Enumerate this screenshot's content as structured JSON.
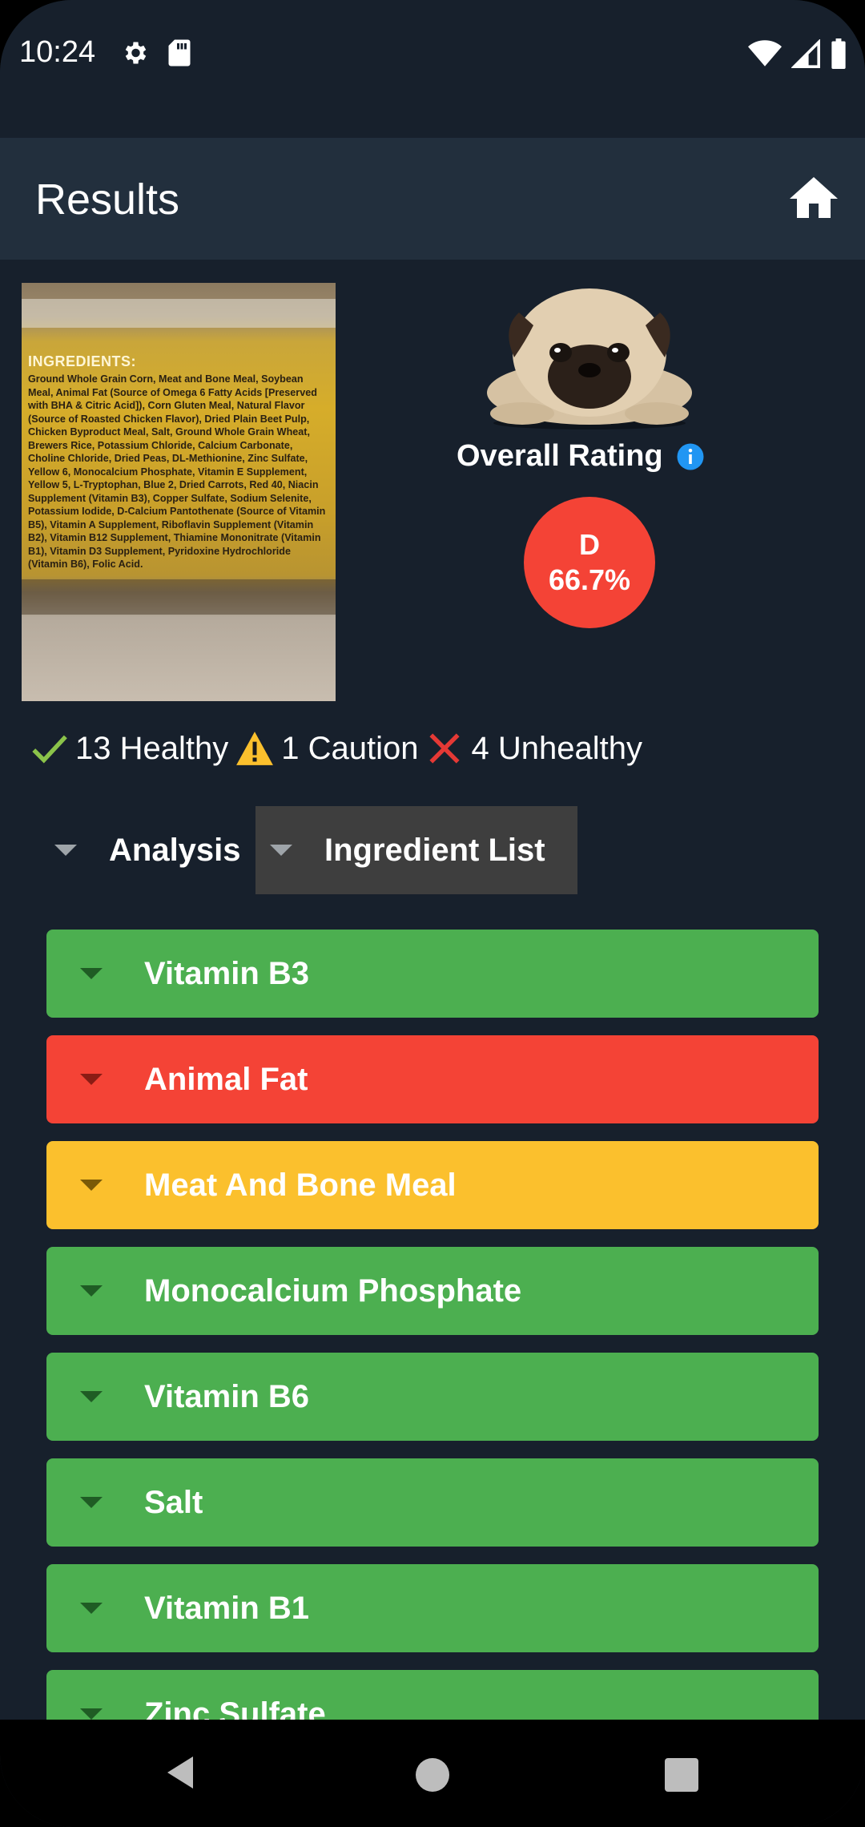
{
  "status": {
    "time": "10:24",
    "icons": [
      "settings-icon",
      "sd-card-icon",
      "wifi-icon",
      "signal-icon",
      "battery-icon"
    ]
  },
  "appbar": {
    "title": "Results",
    "home_icon": "home-icon"
  },
  "label_photo": {
    "heading": "INGREDIENTS:",
    "text": "Ground Whole Grain Corn, Meat and Bone Meal, Soybean Meal, Animal Fat (Source of Omega 6 Fatty Acids [Preserved with BHA & Citric Acid]), Corn Gluten Meal, Natural Flavor (Source of Roasted Chicken Flavor), Dried Plain Beet Pulp, Chicken Byproduct Meal, Salt, Ground Whole Grain Wheat, Brewers Rice, Potassium Chloride, Calcium Carbonate, Choline Chloride, Dried Peas, DL-Methionine, Zinc Sulfate, Yellow 6, Monocalcium Phosphate, Vitamin E Supplement, Yellow 5, L-Tryptophan, Blue 2, Dried Carrots, Red 40, Niacin Supplement (Vitamin B3), Copper Sulfate, Sodium Selenite, Potassium Iodide, D-Calcium Pantothenate (Source of Vitamin B5), Vitamin A Supplement, Riboflavin Supplement (Vitamin B2), Vitamin B12 Supplement, Thiamine Mononitrate (Vitamin B1), Vitamin D3 Supplement, Pyridoxine Hydrochloride (Vitamin B6), Folic Acid."
  },
  "rating": {
    "label": "Overall Rating",
    "grade": "D",
    "percent": "66.7%",
    "color": "#f44336"
  },
  "counts": {
    "healthy": "13 Healthy",
    "caution": "1 Caution",
    "unhealthy": "4 Unhealthy"
  },
  "tabs": {
    "analysis": "Analysis",
    "ingredient_list": "Ingredient List"
  },
  "ingredients": [
    {
      "label": "Vitamin B3",
      "status": "healthy"
    },
    {
      "label": "Animal Fat",
      "status": "unhealthy"
    },
    {
      "label": "Meat And Bone Meal",
      "status": "caution"
    },
    {
      "label": "Monocalcium Phosphate",
      "status": "healthy"
    },
    {
      "label": "Vitamin B6",
      "status": "healthy"
    },
    {
      "label": "Salt",
      "status": "healthy"
    },
    {
      "label": "Vitamin B1",
      "status": "healthy"
    },
    {
      "label": "Zinc Sulfate",
      "status": "healthy"
    }
  ],
  "colors": {
    "healthy": "#4caf50",
    "unhealthy": "#f44336",
    "caution": "#fbc02d",
    "background": "#17202c",
    "appbar": "#222f3d"
  }
}
